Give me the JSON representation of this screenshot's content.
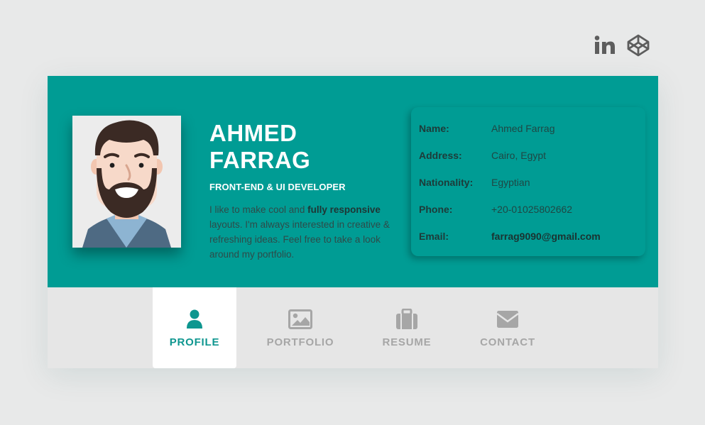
{
  "social": {
    "icons": [
      "linkedin-icon",
      "codepen-icon"
    ]
  },
  "profile": {
    "first_name": "AHMED",
    "last_name": "FARRAG",
    "role": "FRONT-END & UI DEVELOPER",
    "bio_part1": "I like to make cool and ",
    "bio_bold": "fully responsive",
    "bio_part2": " layouts. I'm always interested in creative & refreshing ideas. Feel free to take a look around my portfolio."
  },
  "info": [
    {
      "label": "Name:",
      "value": "Ahmed Farrag"
    },
    {
      "label": "Address:",
      "value": "Cairo, Egypt"
    },
    {
      "label": "Nationality:",
      "value": "Egyptian"
    },
    {
      "label": "Phone:",
      "value": "+20-01025802662"
    },
    {
      "label": "Email:",
      "value": "farrag9090@gmail.com"
    }
  ],
  "tabs": [
    {
      "label": "PROFILE",
      "icon": "user-icon",
      "active": true
    },
    {
      "label": "PORTFOLIO",
      "icon": "image-icon",
      "active": false
    },
    {
      "label": "RESUME",
      "icon": "briefcase-icon",
      "active": false
    },
    {
      "label": "CONTACT",
      "icon": "envelope-icon",
      "active": false
    }
  ],
  "colors": {
    "background": "#e8e9e9",
    "accent": "#009c94",
    "active_tab_text": "#0e968f",
    "inactive_tab_text": "#a6a6a6"
  }
}
